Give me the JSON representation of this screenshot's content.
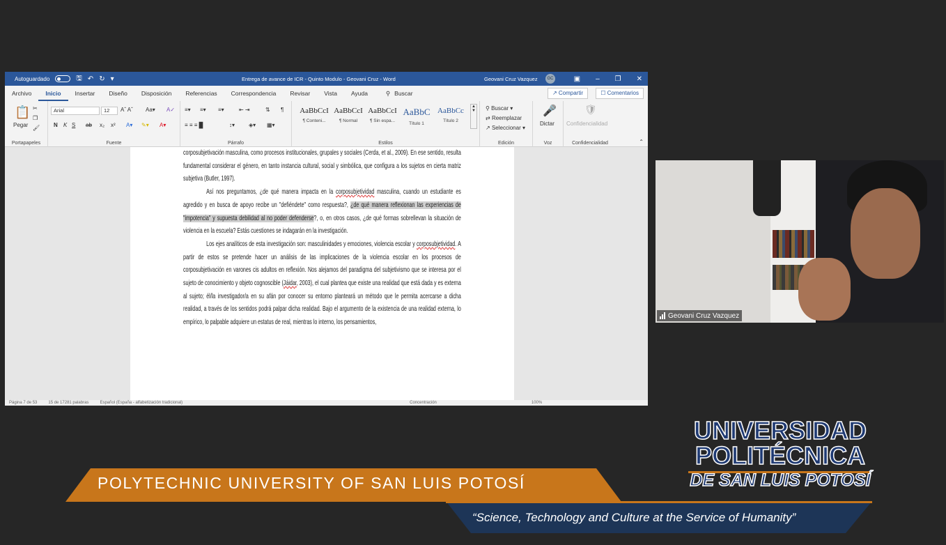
{
  "word": {
    "titlebar": {
      "autosave_label": "Autoguardado",
      "doc_title": "Entrega de avance de ICR - Quinto Modulo - Geovani Cruz - Word",
      "user": "Geovani Cruz Vazquez",
      "user_initials": "GC"
    },
    "tabs": [
      "Archivo",
      "Inicio",
      "Insertar",
      "Diseño",
      "Disposición",
      "Referencias",
      "Correspondencia",
      "Revisar",
      "Vista",
      "Ayuda"
    ],
    "search_label": "Buscar",
    "share_label": "Compartir",
    "comments_label": "Comentarios",
    "ribbon": {
      "paste_label": "Pegar",
      "clipboard_group": "Portapapeles",
      "font_name": "Arial",
      "font_size": "12",
      "font_group": "Fuente",
      "paragraph_group": "Párrafo",
      "styles_group": "Estilos",
      "styles": [
        {
          "sample": "AaBbCcI",
          "name": "¶ Conteni..."
        },
        {
          "sample": "AaBbCcI",
          "name": "¶ Normal"
        },
        {
          "sample": "AaBbCcI",
          "name": "¶ Sin espa..."
        },
        {
          "sample": "AaBbC",
          "name": "Título 1"
        },
        {
          "sample": "AaBbCc",
          "name": "Título 2"
        }
      ],
      "find_label": "Buscar",
      "replace_label": "Reemplazar",
      "select_label": "Seleccionar",
      "edit_group": "Edición",
      "dictate_label": "Dictar",
      "voice_group": "Voz",
      "sensitivity_label": "Confidencialidad",
      "sensitivity_group": "Confidencialidad"
    },
    "document": {
      "p1": "corposubjetivación masculina, como procesos institucionales, grupales y sociales (Cerda, et al., 2009). En ese sentido, resulta fundamental considerar el género, en tanto instancia cultural, social y simbólica, que configura a los sujetos en cierta matriz subjetiva (Butler, 1997).",
      "p2_a": "Así nos preguntamos, ¿de qué manera impacta en la ",
      "p2_b": "corposubjetividad",
      "p2_c": " masculina, cuando un estudiante es agredido y en busca de apoyo recibe un \"defiéndete\" como respuesta?, ",
      "p2_hl": "¿de qué manera reflexionan las experiencias de \"impotencia\" y supuesta debilidad al no poder defenderse",
      "p2_d": "?, o, en otros casos, ¿de qué formas sobrellevan la situación de violencia en la escuela? Estás cuestiones se indagarán en la investigación.",
      "p3_a": "Los ejes analíticos de esta investigación son: masculinidades y emociones, violencia escolar y ",
      "p3_b": "corposubjetividad",
      "p3_c": ". A partir de estos se pretende hacer un análisis de las implicaciones de la violencia escolar en los procesos de corposubjetivación en varones cis adultos en reflexión. Nos alejamos del paradigma del subjetivismo que se interesa por el sujeto de conocimiento y objeto cognoscible (",
      "p3_d": "Jáidar",
      "p3_e": ", 2003), el cual plantea que existe una realidad que está dada y es externa al sujeto; él/la investigador/a en su afán por conocer su entorno planteará un método que le permita acercarse a dicha realidad, a través de los sentidos podrá palpar dicha realidad. Bajo el argumento de la existencia de una realidad externa, lo empírico, lo palpable adquiere un estatus de real, mientras lo interno, los pensamientos,"
    },
    "status": {
      "page": "Página 7 de 53",
      "words": "15 de 17281 palabras",
      "language": "Español (España - alfabetización tradicional)",
      "focus": "Concentración",
      "zoom": "100%"
    }
  },
  "webcam": {
    "participant_name": "Geovani Cruz Vazquez"
  },
  "branding": {
    "banner": "POLYTECHNIC UNIVERSITY OF SAN LUIS POTOSÍ",
    "slogan": "“Science, Technology and Culture at the Service of Humanity”",
    "logo_line1": "UNIVERSIDAD",
    "logo_line2": "POLITÉCNICA",
    "logo_line3": "DE SAN LUIS POTOSÍ",
    "colors": {
      "orange": "#c8761b",
      "navy": "#1d3557",
      "word_blue": "#2b579a"
    }
  }
}
